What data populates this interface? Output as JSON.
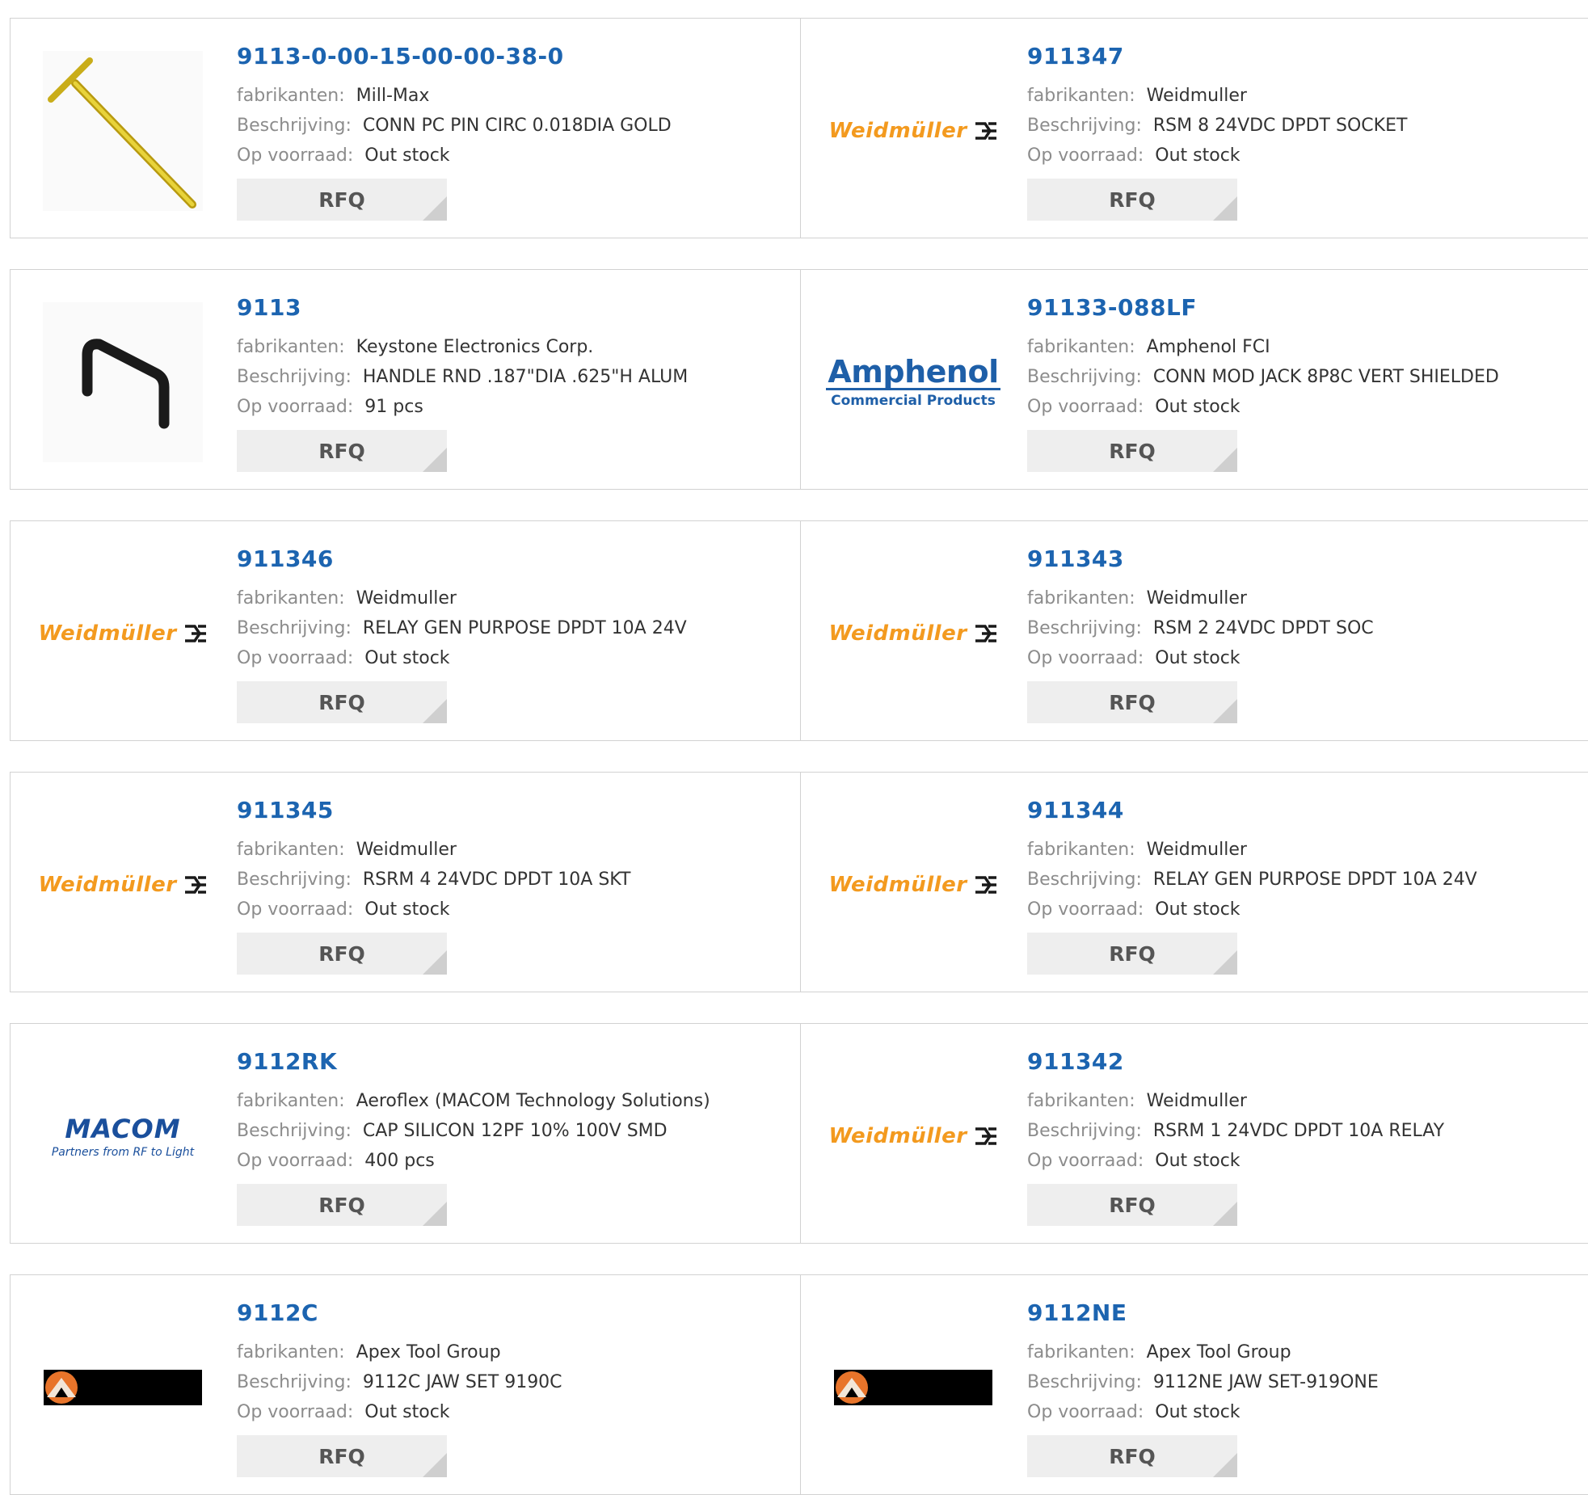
{
  "labels": {
    "manufacturer": "fabrikanten:",
    "description": "Beschrijving:",
    "stock": "Op voorraad:",
    "rfq": "RFQ"
  },
  "colors": {
    "link": "#1c64b0",
    "label": "#8c8c8c",
    "weidmuller_orange": "#f39a1f",
    "amphenol_blue": "#1e5fa8",
    "macom_blue": "#1a4f9c",
    "button_bg": "#eeeeee"
  },
  "brand_logos": {
    "weidmuller": "Weidmüller",
    "amphenol_main": "Amphenol",
    "amphenol_sub": "Commercial Products",
    "macom_main": "MACOM",
    "macom_sub": "Partners from RF to Light"
  },
  "products": [
    {
      "part": "9113-0-00-15-00-00-38-0",
      "manufacturer": "Mill-Max",
      "description": "CONN PC PIN CIRC 0.018DIA GOLD",
      "stock": "Out stock",
      "logo": "pin-photo"
    },
    {
      "part": "911347",
      "manufacturer": "Weidmuller",
      "description": "RSM 8 24VDC DPDT SOCKET",
      "stock": "Out stock",
      "logo": "weidmuller-logo"
    },
    {
      "part": "9113",
      "manufacturer": "Keystone Electronics Corp.",
      "description": "HANDLE RND .187\"DIA .625\"H ALUM",
      "stock": "91 pcs",
      "logo": "handle-photo"
    },
    {
      "part": "91133-088LF",
      "manufacturer": "Amphenol FCI",
      "description": "CONN MOD JACK 8P8C VERT SHIELDED",
      "stock": "Out stock",
      "logo": "amphenol-logo"
    },
    {
      "part": "911346",
      "manufacturer": "Weidmuller",
      "description": "RELAY GEN PURPOSE DPDT 10A 24V",
      "stock": "Out stock",
      "logo": "weidmuller-logo"
    },
    {
      "part": "911343",
      "manufacturer": "Weidmuller",
      "description": "RSM 2 24VDC DPDT SOC",
      "stock": "Out stock",
      "logo": "weidmuller-logo"
    },
    {
      "part": "911345",
      "manufacturer": "Weidmuller",
      "description": "RSRM 4 24VDC DPDT 10A SKT",
      "stock": "Out stock",
      "logo": "weidmuller-logo"
    },
    {
      "part": "911344",
      "manufacturer": "Weidmuller",
      "description": "RELAY GEN PURPOSE DPDT 10A 24V",
      "stock": "Out stock",
      "logo": "weidmuller-logo"
    },
    {
      "part": "9112RK",
      "manufacturer": "Aeroflex (MACOM Technology Solutions)",
      "description": "CAP SILICON 12PF 10% 100V SMD",
      "stock": "400 pcs",
      "logo": "macom-logo"
    },
    {
      "part": "911342",
      "manufacturer": "Weidmuller",
      "description": "RSRM 1 24VDC DPDT 10A RELAY",
      "stock": "Out stock",
      "logo": "weidmuller-logo"
    },
    {
      "part": "9112C",
      "manufacturer": "Apex Tool Group",
      "description": "9112C JAW SET 9190C",
      "stock": "Out stock",
      "logo": "apex-logo"
    },
    {
      "part": "9112NE",
      "manufacturer": "Apex Tool Group",
      "description": "9112NE JAW SET-919ONE",
      "stock": "Out stock",
      "logo": "apex-logo"
    }
  ]
}
